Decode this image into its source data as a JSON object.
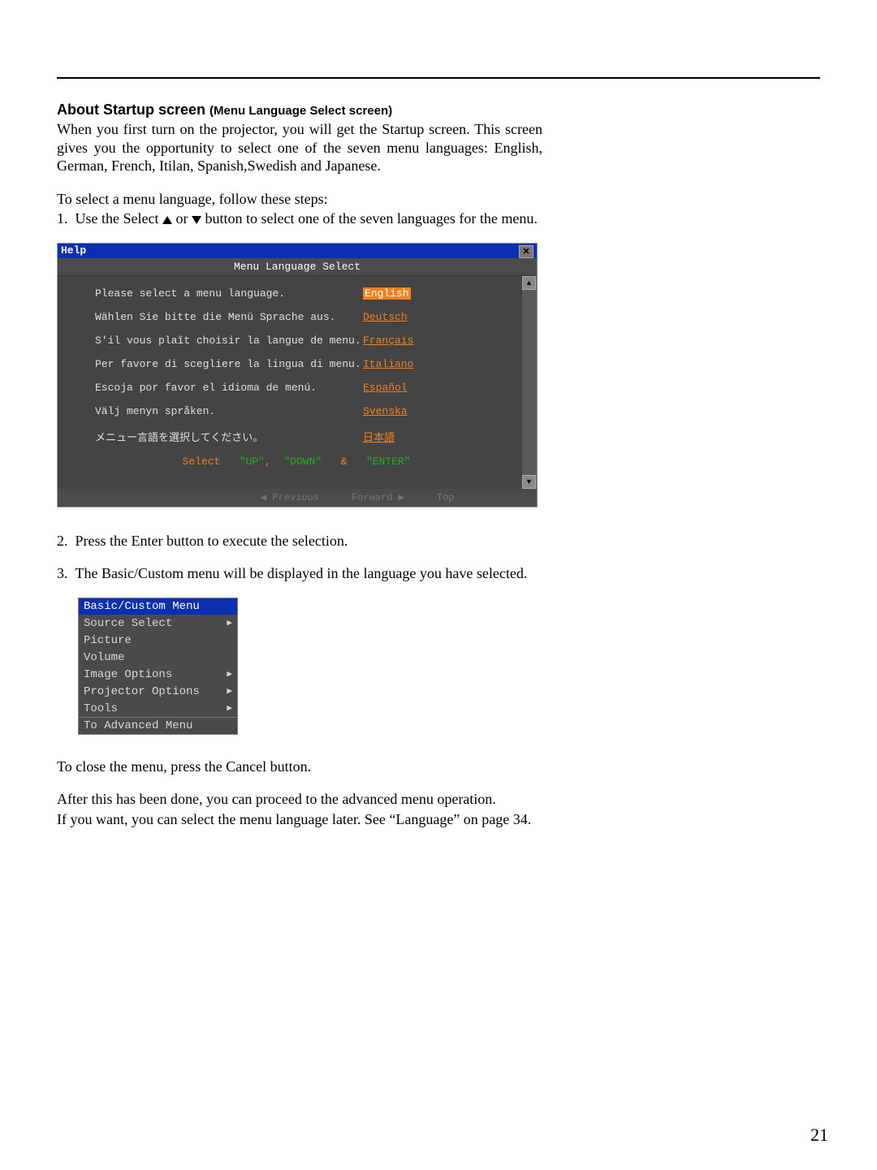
{
  "page_number": "21",
  "heading": {
    "main": "About Startup screen",
    "sub": "(Menu Language Select screen)"
  },
  "intro_para": "When you first turn on the projector, you will get the Startup screen. This screen gives you the opportunity to select one of the seven menu languages: English, German, French, Itilan, Spanish,Swedish and Japanese.",
  "steps_lead": "To select a menu language, follow these steps:",
  "step1_prefix": "1.  Use the Select ",
  "step1_mid": " or ",
  "step1_suffix": " button to select one of the seven languages for the menu.",
  "osd": {
    "title": "Help",
    "subtitle": "Menu Language Select",
    "rows": [
      {
        "prompt": "Please select a menu language.",
        "lang": "English",
        "selected": true
      },
      {
        "prompt": "Wählen Sie bitte die Menü Sprache aus.",
        "lang": "Deutsch",
        "selected": false
      },
      {
        "prompt": "S'il vous plaît choisir la langue de menu.",
        "lang": "Français",
        "selected": false
      },
      {
        "prompt": "Per favore di scegliere la lingua di menu.",
        "lang": "Italiano",
        "selected": false
      },
      {
        "prompt": "Escoja por favor el idioma de menú.",
        "lang": "Español",
        "selected": false
      },
      {
        "prompt": "Välj menyn språken.",
        "lang": "Svenska",
        "selected": false
      },
      {
        "prompt": "メニュー言語を選択してください。",
        "lang": "日本語",
        "selected": false
      }
    ],
    "hint_select": "Select",
    "hint_up": "\"UP\"",
    "hint_comma": ",",
    "hint_down": "\"DOWN\"",
    "hint_amp": "&",
    "hint_enter": "\"ENTER\"",
    "footer_prev": "◀ Previous",
    "footer_fwd": "Forward ▶",
    "footer_top": "Top"
  },
  "step2": "2.  Press the Enter button to execute the selection.",
  "step3": "3.  The Basic/Custom menu will be displayed in the language you have selected.",
  "bc_menu": {
    "title": "Basic/Custom Menu",
    "items": [
      {
        "label": "Source Select",
        "arrow": true
      },
      {
        "label": "Picture",
        "arrow": false
      },
      {
        "label": "Volume",
        "arrow": false
      },
      {
        "label": "Image Options",
        "arrow": true
      },
      {
        "label": "Projector Options",
        "arrow": true
      },
      {
        "label": "Tools",
        "arrow": true
      }
    ],
    "last": "To Advanced Menu"
  },
  "close_para": "To close the menu, press the Cancel button.",
  "after_para1": "After this has been done, you can proceed to the advanced menu operation.",
  "after_para2": "If you want, you can select the menu language later. See “Language” on page 34."
}
